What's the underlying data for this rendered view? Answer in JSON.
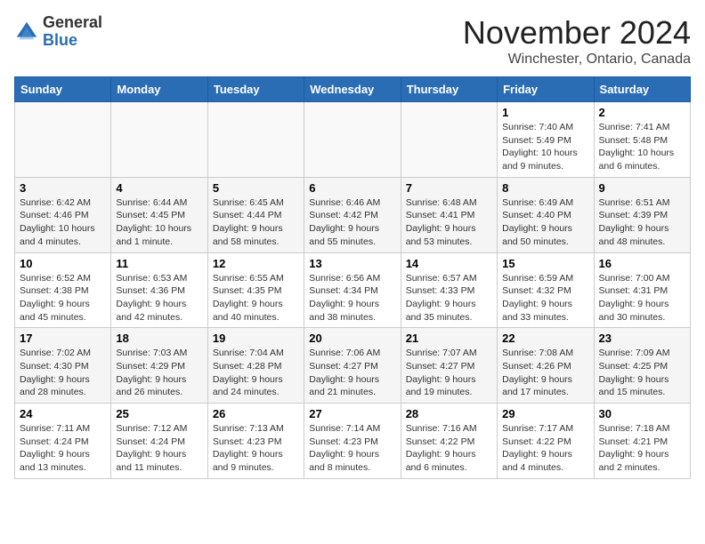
{
  "header": {
    "logo_general": "General",
    "logo_blue": "Blue",
    "month_title": "November 2024",
    "location": "Winchester, Ontario, Canada"
  },
  "days_of_week": [
    "Sunday",
    "Monday",
    "Tuesday",
    "Wednesday",
    "Thursday",
    "Friday",
    "Saturday"
  ],
  "weeks": [
    [
      {
        "day": "",
        "info": ""
      },
      {
        "day": "",
        "info": ""
      },
      {
        "day": "",
        "info": ""
      },
      {
        "day": "",
        "info": ""
      },
      {
        "day": "",
        "info": ""
      },
      {
        "day": "1",
        "info": "Sunrise: 7:40 AM\nSunset: 5:49 PM\nDaylight: 10 hours and 9 minutes."
      },
      {
        "day": "2",
        "info": "Sunrise: 7:41 AM\nSunset: 5:48 PM\nDaylight: 10 hours and 6 minutes."
      }
    ],
    [
      {
        "day": "3",
        "info": "Sunrise: 6:42 AM\nSunset: 4:46 PM\nDaylight: 10 hours and 4 minutes."
      },
      {
        "day": "4",
        "info": "Sunrise: 6:44 AM\nSunset: 4:45 PM\nDaylight: 10 hours and 1 minute."
      },
      {
        "day": "5",
        "info": "Sunrise: 6:45 AM\nSunset: 4:44 PM\nDaylight: 9 hours and 58 minutes."
      },
      {
        "day": "6",
        "info": "Sunrise: 6:46 AM\nSunset: 4:42 PM\nDaylight: 9 hours and 55 minutes."
      },
      {
        "day": "7",
        "info": "Sunrise: 6:48 AM\nSunset: 4:41 PM\nDaylight: 9 hours and 53 minutes."
      },
      {
        "day": "8",
        "info": "Sunrise: 6:49 AM\nSunset: 4:40 PM\nDaylight: 9 hours and 50 minutes."
      },
      {
        "day": "9",
        "info": "Sunrise: 6:51 AM\nSunset: 4:39 PM\nDaylight: 9 hours and 48 minutes."
      }
    ],
    [
      {
        "day": "10",
        "info": "Sunrise: 6:52 AM\nSunset: 4:38 PM\nDaylight: 9 hours and 45 minutes."
      },
      {
        "day": "11",
        "info": "Sunrise: 6:53 AM\nSunset: 4:36 PM\nDaylight: 9 hours and 42 minutes."
      },
      {
        "day": "12",
        "info": "Sunrise: 6:55 AM\nSunset: 4:35 PM\nDaylight: 9 hours and 40 minutes."
      },
      {
        "day": "13",
        "info": "Sunrise: 6:56 AM\nSunset: 4:34 PM\nDaylight: 9 hours and 38 minutes."
      },
      {
        "day": "14",
        "info": "Sunrise: 6:57 AM\nSunset: 4:33 PM\nDaylight: 9 hours and 35 minutes."
      },
      {
        "day": "15",
        "info": "Sunrise: 6:59 AM\nSunset: 4:32 PM\nDaylight: 9 hours and 33 minutes."
      },
      {
        "day": "16",
        "info": "Sunrise: 7:00 AM\nSunset: 4:31 PM\nDaylight: 9 hours and 30 minutes."
      }
    ],
    [
      {
        "day": "17",
        "info": "Sunrise: 7:02 AM\nSunset: 4:30 PM\nDaylight: 9 hours and 28 minutes."
      },
      {
        "day": "18",
        "info": "Sunrise: 7:03 AM\nSunset: 4:29 PM\nDaylight: 9 hours and 26 minutes."
      },
      {
        "day": "19",
        "info": "Sunrise: 7:04 AM\nSunset: 4:28 PM\nDaylight: 9 hours and 24 minutes."
      },
      {
        "day": "20",
        "info": "Sunrise: 7:06 AM\nSunset: 4:27 PM\nDaylight: 9 hours and 21 minutes."
      },
      {
        "day": "21",
        "info": "Sunrise: 7:07 AM\nSunset: 4:27 PM\nDaylight: 9 hours and 19 minutes."
      },
      {
        "day": "22",
        "info": "Sunrise: 7:08 AM\nSunset: 4:26 PM\nDaylight: 9 hours and 17 minutes."
      },
      {
        "day": "23",
        "info": "Sunrise: 7:09 AM\nSunset: 4:25 PM\nDaylight: 9 hours and 15 minutes."
      }
    ],
    [
      {
        "day": "24",
        "info": "Sunrise: 7:11 AM\nSunset: 4:24 PM\nDaylight: 9 hours and 13 minutes."
      },
      {
        "day": "25",
        "info": "Sunrise: 7:12 AM\nSunset: 4:24 PM\nDaylight: 9 hours and 11 minutes."
      },
      {
        "day": "26",
        "info": "Sunrise: 7:13 AM\nSunset: 4:23 PM\nDaylight: 9 hours and 9 minutes."
      },
      {
        "day": "27",
        "info": "Sunrise: 7:14 AM\nSunset: 4:23 PM\nDaylight: 9 hours and 8 minutes."
      },
      {
        "day": "28",
        "info": "Sunrise: 7:16 AM\nSunset: 4:22 PM\nDaylight: 9 hours and 6 minutes."
      },
      {
        "day": "29",
        "info": "Sunrise: 7:17 AM\nSunset: 4:22 PM\nDaylight: 9 hours and 4 minutes."
      },
      {
        "day": "30",
        "info": "Sunrise: 7:18 AM\nSunset: 4:21 PM\nDaylight: 9 hours and 2 minutes."
      }
    ]
  ]
}
